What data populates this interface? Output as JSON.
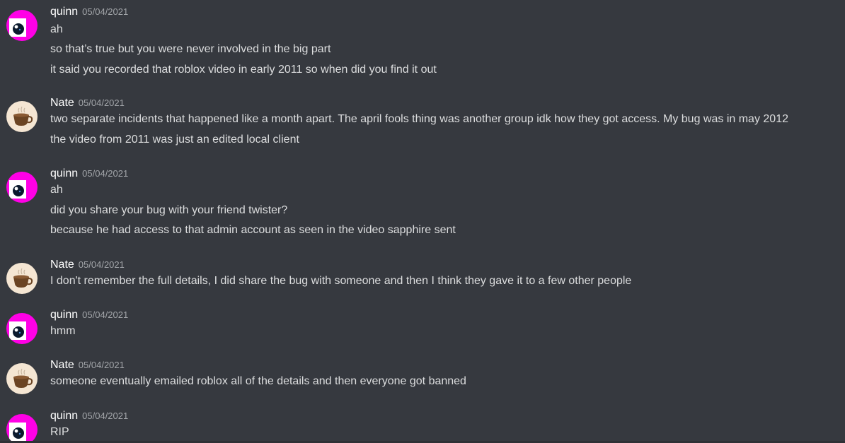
{
  "messages": [
    {
      "author": "quinn",
      "avatar": "quinn-avatar-icon",
      "timestamp": "05/04/2021",
      "lines": [
        "ah",
        "so that’s true but you were never involved in the big part",
        "it said you recorded that roblox video in early 2011 so when did you find it out"
      ]
    },
    {
      "author": "Nate",
      "avatar": "coffee-cup-avatar-icon",
      "timestamp": "05/04/2021",
      "lines": [
        "two separate incidents that happened like a month apart. The april fools thing was another group idk how they got access. My bug was in may 2012",
        "the video from 2011 was just an edited local client"
      ]
    },
    {
      "author": "quinn",
      "avatar": "quinn-avatar-icon",
      "timestamp": "05/04/2021",
      "lines": [
        "ah",
        "did you share your bug with your friend twister?",
        "because he had access to that admin account as seen in the video sapphire sent"
      ]
    },
    {
      "author": "Nate",
      "avatar": "coffee-cup-avatar-icon",
      "timestamp": "05/04/2021",
      "lines": [
        "I don't remember the full details, I did share the bug with someone and then I think they gave it to a few other people"
      ]
    },
    {
      "author": "quinn",
      "avatar": "quinn-avatar-icon",
      "timestamp": "05/04/2021",
      "lines": [
        "hmm"
      ]
    },
    {
      "author": "Nate",
      "avatar": "coffee-cup-avatar-icon",
      "timestamp": "05/04/2021",
      "lines": [
        "someone eventually emailed roblox all of the details and then everyone got banned"
      ]
    },
    {
      "author": "quinn",
      "avatar": "quinn-avatar-icon",
      "timestamp": "05/04/2021",
      "lines": [
        "RIP"
      ]
    }
  ],
  "colors": {
    "background": "#36393f",
    "username": "#ffffff",
    "text": "#dcddde",
    "timestamp": "#a3a6aa",
    "quinn_avatar_primary": "#ff00e6",
    "nate_avatar_bg": "#f5e6d3"
  }
}
